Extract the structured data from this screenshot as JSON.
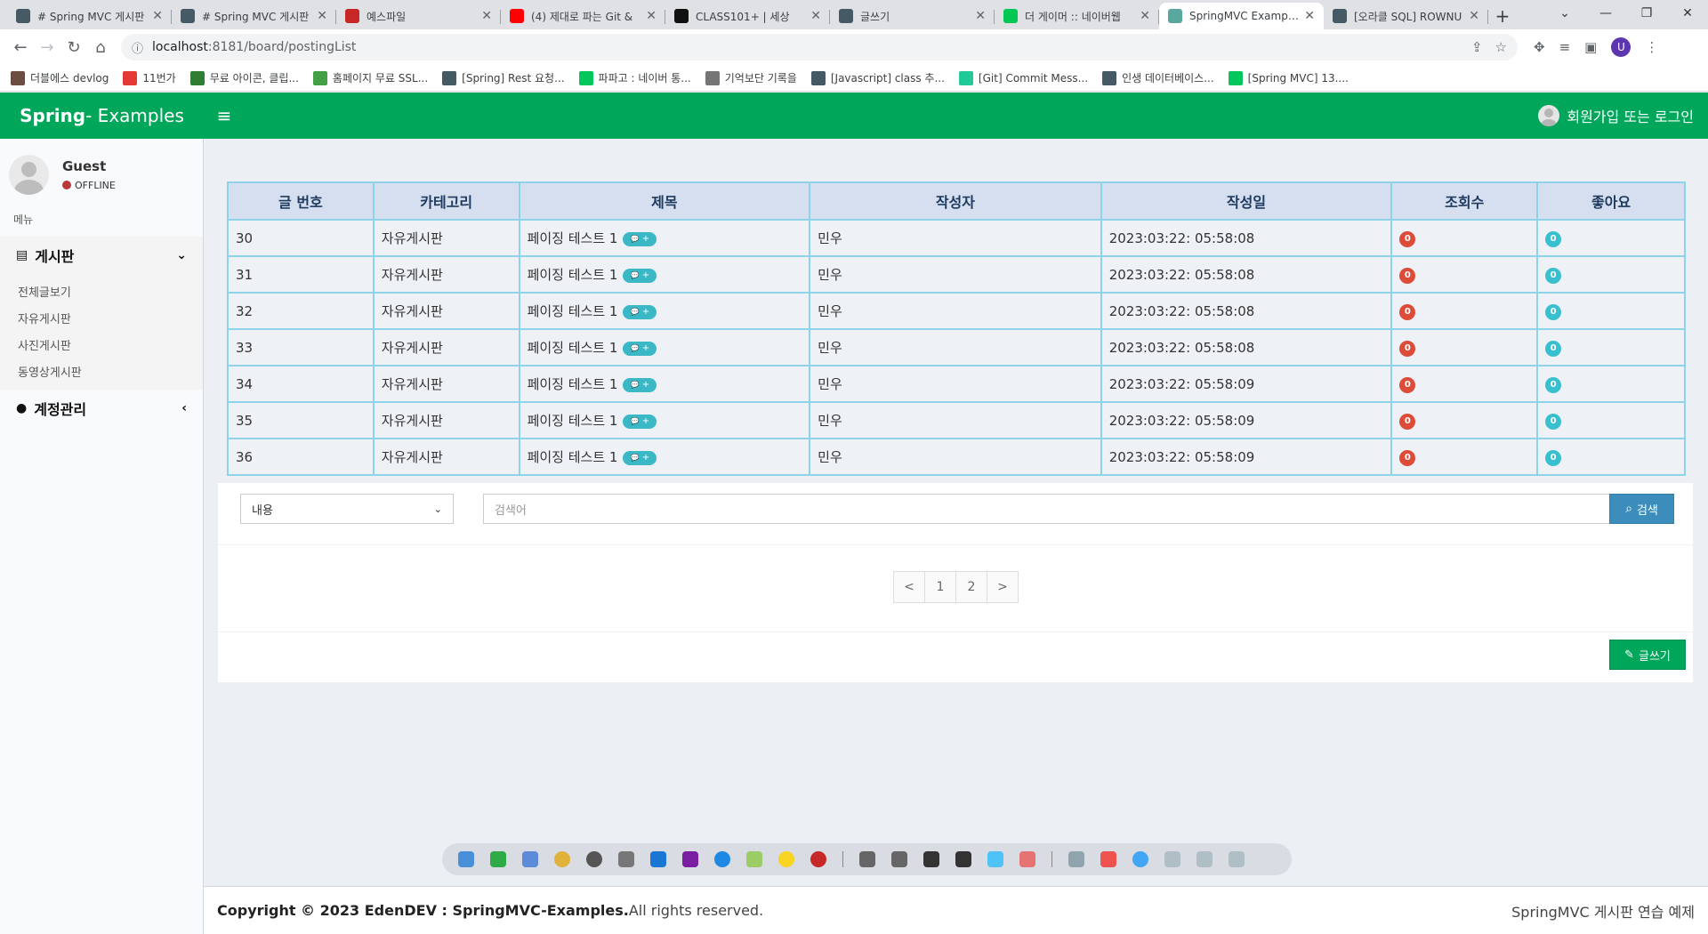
{
  "browser": {
    "tabs": [
      {
        "title": "# Spring MVC 게시판",
        "active": false
      },
      {
        "title": "# Spring MVC 게시판",
        "active": false
      },
      {
        "title": "예스파일",
        "active": false
      },
      {
        "title": "(4) 제대로 파는 Git &",
        "active": false
      },
      {
        "title": "CLASS101+ | 세상",
        "active": false
      },
      {
        "title": "글쓰기",
        "active": false
      },
      {
        "title": "더 게이머 :: 네이버웹",
        "active": false
      },
      {
        "title": "SpringMVC Examples",
        "active": true
      },
      {
        "title": "[오라클 SQL] ROWNU",
        "active": false
      }
    ],
    "url_host": "localhost",
    "url_path": ":8181/board/postingList",
    "profile_letter": "U",
    "bookmarks": [
      {
        "label": "더블에스 devlog",
        "color": "#6d4c41"
      },
      {
        "label": "11번가",
        "color": "#e53935"
      },
      {
        "label": "무료 아이콘, 클립...",
        "color": "#2e7d32"
      },
      {
        "label": "홈페이지 무료 SSL...",
        "color": "#43a047"
      },
      {
        "label": "[Spring] Rest 요청...",
        "color": "#455a64"
      },
      {
        "label": "파파고 : 네이버 통...",
        "color": "#03c75a"
      },
      {
        "label": "기억보단 기록을",
        "color": "#757575"
      },
      {
        "label": "[Javascript] class 추...",
        "color": "#455a64"
      },
      {
        "label": "[Git] Commit Mess...",
        "color": "#20c997"
      },
      {
        "label": "인생 데이터베이스...",
        "color": "#455a64"
      },
      {
        "label": "[Spring MVC] 13....",
        "color": "#03c75a"
      }
    ]
  },
  "header": {
    "logo_bold": "Spring",
    "logo_thin": " - Examples",
    "login_label": "회원가입 또는 로그인"
  },
  "sidebar": {
    "user_name": "Guest",
    "user_status": "OFFLINE",
    "menu_header": "메뉴",
    "board_menu": {
      "label": "게시판",
      "items": [
        "전체글보기",
        "자유게시판",
        "사진게시판",
        "동영상게시판"
      ]
    },
    "account_menu": {
      "label": "계정관리"
    }
  },
  "table": {
    "headers": [
      "글 번호",
      "카테고리",
      "제목",
      "작성자",
      "작성일",
      "조회수",
      "좋아요"
    ],
    "comment_badge": "+",
    "rows": [
      {
        "no": "30",
        "category": "자유게시판",
        "title": "페이징 테스트 1",
        "author": "민우",
        "date": "2023:03:22: 05:58:08",
        "views": "0",
        "likes": "0"
      },
      {
        "no": "31",
        "category": "자유게시판",
        "title": "페이징 테스트 1",
        "author": "민우",
        "date": "2023:03:22: 05:58:08",
        "views": "0",
        "likes": "0"
      },
      {
        "no": "32",
        "category": "자유게시판",
        "title": "페이징 테스트 1",
        "author": "민우",
        "date": "2023:03:22: 05:58:08",
        "views": "0",
        "likes": "0"
      },
      {
        "no": "33",
        "category": "자유게시판",
        "title": "페이징 테스트 1",
        "author": "민우",
        "date": "2023:03:22: 05:58:08",
        "views": "0",
        "likes": "0"
      },
      {
        "no": "34",
        "category": "자유게시판",
        "title": "페이징 테스트 1",
        "author": "민우",
        "date": "2023:03:22: 05:58:09",
        "views": "0",
        "likes": "0"
      },
      {
        "no": "35",
        "category": "자유게시판",
        "title": "페이징 테스트 1",
        "author": "민우",
        "date": "2023:03:22: 05:58:09",
        "views": "0",
        "likes": "0"
      },
      {
        "no": "36",
        "category": "자유게시판",
        "title": "페이징 테스트 1",
        "author": "민우",
        "date": "2023:03:22: 05:58:09",
        "views": "0",
        "likes": "0"
      }
    ]
  },
  "search": {
    "select_value": "내용",
    "placeholder": "검색어",
    "button_label": "검색"
  },
  "pagination": {
    "prev": "<",
    "pages": [
      "1",
      "2"
    ],
    "next": ">"
  },
  "write_button": "글쓰기",
  "footer": {
    "copyright_bold": "Copyright © 2023 EdenDEV : SpringMVC-Examples.",
    "copyright_rest": " All rights reserved.",
    "right_text": "SpringMVC 게시판 연습 예제"
  },
  "colors": {
    "brand": "#00a65a",
    "primary_button": "#3c8dbc",
    "badge_red": "#dd4b39",
    "badge_teal": "#39c0d0",
    "table_border": "#8ed3e8",
    "table_header_bg": "#d5dff0"
  }
}
